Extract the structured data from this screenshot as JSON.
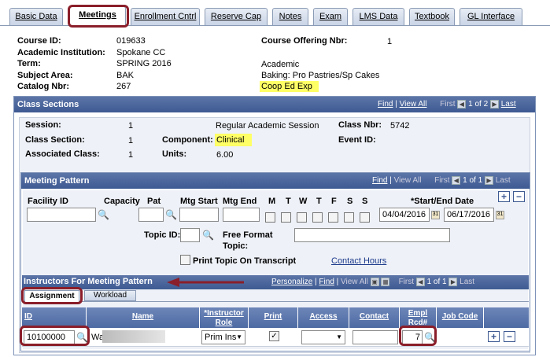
{
  "tabs": [
    {
      "label": "Basic Data"
    },
    {
      "label": "Meetings"
    },
    {
      "label": "Enrollment Cntrl"
    },
    {
      "label": "Reserve Cap"
    },
    {
      "label": "Notes"
    },
    {
      "label": "Exam"
    },
    {
      "label": "LMS Data"
    },
    {
      "label": "Textbook"
    },
    {
      "label": "GL Interface"
    }
  ],
  "course": {
    "course_id_label": "Course ID:",
    "course_id": "019633",
    "institution_label": "Academic Institution:",
    "institution": "Spokane CC",
    "term_label": "Term:",
    "term": "SPRING 2016",
    "subject_label": "Subject Area:",
    "subject": "BAK",
    "catalog_label": "Catalog Nbr:",
    "catalog": "267",
    "offering_label": "Course Offering Nbr:",
    "offering": "1",
    "career": "Academic",
    "subject_desc": "Baking:  Pro Pastries/Sp Cakes",
    "title": "Coop Ed Exp"
  },
  "class_sections": {
    "title": "Class Sections",
    "find": "Find",
    "view_all": "View All",
    "first": "First",
    "range": "1 of 2",
    "last": "Last",
    "session_label": "Session:",
    "session": "1",
    "session_desc": "Regular Academic Session",
    "class_nbr_label": "Class Nbr:",
    "class_nbr": "5742",
    "section_label": "Class Section:",
    "section": "1",
    "component_label": "Component:",
    "component": "Clinical",
    "event_label": "Event ID:",
    "assoc_label": "Associated Class:",
    "assoc": "1",
    "units_label": "Units:",
    "units": "6.00"
  },
  "meeting_pattern": {
    "title": "Meeting Pattern",
    "find": "Find",
    "view_all": "View All",
    "first": "First",
    "range": "1 of 1",
    "last": "Last",
    "facility_label": "Facility ID",
    "capacity_label": "Capacity",
    "pat_label": "Pat",
    "mtg_start_label": "Mtg Start",
    "mtg_end_label": "Mtg End",
    "days": [
      "M",
      "T",
      "W",
      "T",
      "F",
      "S",
      "S"
    ],
    "dates_label": "*Start/End Date",
    "start_date": "04/04/2016",
    "end_date": "06/17/2016",
    "topic_label": "Topic ID:",
    "free_format_label": "Free Format",
    "topic_label2": "Topic:",
    "print_topic_label": "Print Topic On Transcript",
    "contact_hours": "Contact Hours"
  },
  "instructors": {
    "title": "Instructors For Meeting Pattern",
    "personalize": "Personalize",
    "find": "Find",
    "view_all": "View All",
    "first": "First",
    "range": "1 of 1",
    "last": "Last",
    "subtabs": [
      "Assignment",
      "Workload"
    ],
    "columns": [
      "ID",
      "Name",
      "*Instructor Role",
      "Print",
      "Access",
      "Contact",
      "Empl Rcd#",
      "Job Code"
    ],
    "row": {
      "id": "10100000",
      "name": "Wa",
      "role": "Prim Ins",
      "empl_rcd": "7"
    }
  }
}
